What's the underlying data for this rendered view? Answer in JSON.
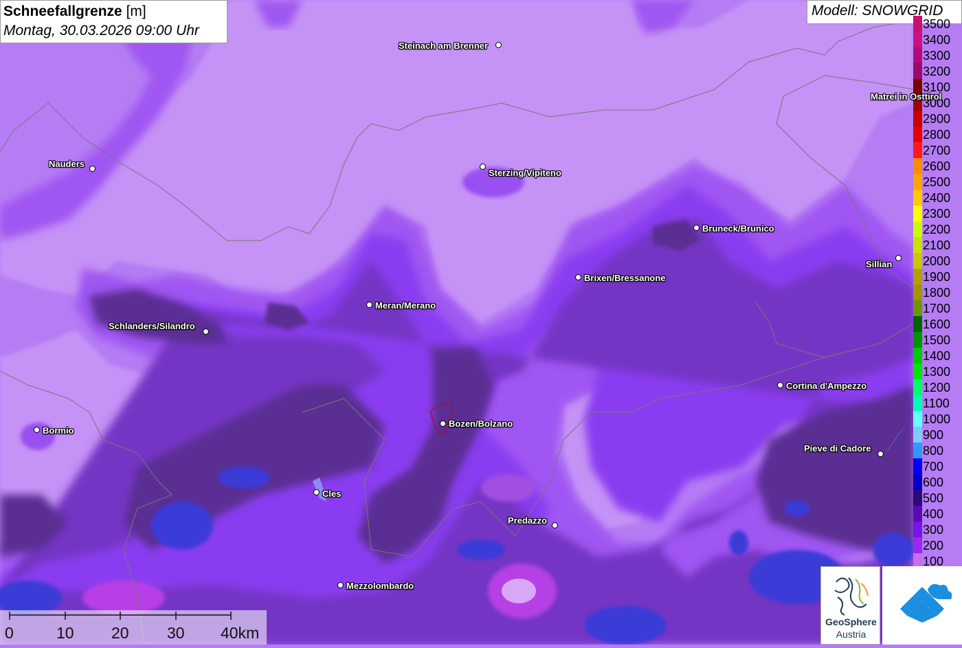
{
  "title": {
    "main": "Schneefallgrenze",
    "unit": "[m]",
    "datetime": "Montag, 30.03.2026 09:00 Uhr"
  },
  "model": "Modell: SNOWGRID",
  "legend": {
    "entries": [
      {
        "label": "3500",
        "color": "#c8106e"
      },
      {
        "label": "3400",
        "color": "#cb1080"
      },
      {
        "label": "3300",
        "color": "#b40a78"
      },
      {
        "label": "3200",
        "color": "#9b0a6a"
      },
      {
        "label": "3100",
        "color": "#7d0000"
      },
      {
        "label": "3000",
        "color": "#a50000"
      },
      {
        "label": "2900",
        "color": "#c80000"
      },
      {
        "label": "2800",
        "color": "#e60000"
      },
      {
        "label": "2700",
        "color": "#ff1a1a"
      },
      {
        "label": "2600",
        "color": "#ff8c00"
      },
      {
        "label": "2500",
        "color": "#ffa500"
      },
      {
        "label": "2400",
        "color": "#ffc800"
      },
      {
        "label": "2300",
        "color": "#ffff00"
      },
      {
        "label": "2200",
        "color": "#c8ff00"
      },
      {
        "label": "2100",
        "color": "#c8e100"
      },
      {
        "label": "2000",
        "color": "#c8c800"
      },
      {
        "label": "1900",
        "color": "#b4a000"
      },
      {
        "label": "1800",
        "color": "#a09600"
      },
      {
        "label": "1700",
        "color": "#6e9600"
      },
      {
        "label": "1600",
        "color": "#006400"
      },
      {
        "label": "1500",
        "color": "#009600"
      },
      {
        "label": "1400",
        "color": "#00c800"
      },
      {
        "label": "1300",
        "color": "#00e600"
      },
      {
        "label": "1200",
        "color": "#00ff64"
      },
      {
        "label": "1100",
        "color": "#00ffb4"
      },
      {
        "label": "1000",
        "color": "#64ffff"
      },
      {
        "label": "900",
        "color": "#82c8ff"
      },
      {
        "label": "800",
        "color": "#3296ff"
      },
      {
        "label": "700",
        "color": "#0000ff"
      },
      {
        "label": "600",
        "color": "#0000c8"
      },
      {
        "label": "500",
        "color": "#2d0a78"
      },
      {
        "label": "400",
        "color": "#5a0ab4"
      },
      {
        "label": "300",
        "color": "#7814e6"
      },
      {
        "label": "200",
        "color": "#9b28f0"
      },
      {
        "label": "100",
        "color": "#c86ef0"
      }
    ]
  },
  "cities": [
    {
      "name": "Steinach am Brenner"
    },
    {
      "name": "Matrei in Osttirol"
    },
    {
      "name": "Nauders"
    },
    {
      "name": "Sterzing/Vipiteno"
    },
    {
      "name": "Bruneck/Brunico"
    },
    {
      "name": "Sillian"
    },
    {
      "name": "Brixen/Bressanone"
    },
    {
      "name": "Meran/Merano"
    },
    {
      "name": "Schlanders/Silandro"
    },
    {
      "name": "Cortina d'Ampezzo"
    },
    {
      "name": "Bormio"
    },
    {
      "name": "Bozen/Bolzano"
    },
    {
      "name": "Pieve di Cadore"
    },
    {
      "name": "Cles"
    },
    {
      "name": "Predazzo"
    },
    {
      "name": "Mezzolombardo"
    }
  ],
  "scalebar": {
    "labels": [
      "0",
      "10",
      "20",
      "30",
      "40km"
    ]
  },
  "logos": {
    "geosphere_line1": "GeoSphere",
    "geosphere_line2": "Austria"
  },
  "colors": {
    "band_100": "#c48af5",
    "band_200": "#a45ef3",
    "band_300": "#8a3ef0",
    "band_400": "#7a38c8",
    "band_500": "#5b2e94",
    "band_700": "#3a3ae0",
    "band_magenta": "#b640e6"
  }
}
